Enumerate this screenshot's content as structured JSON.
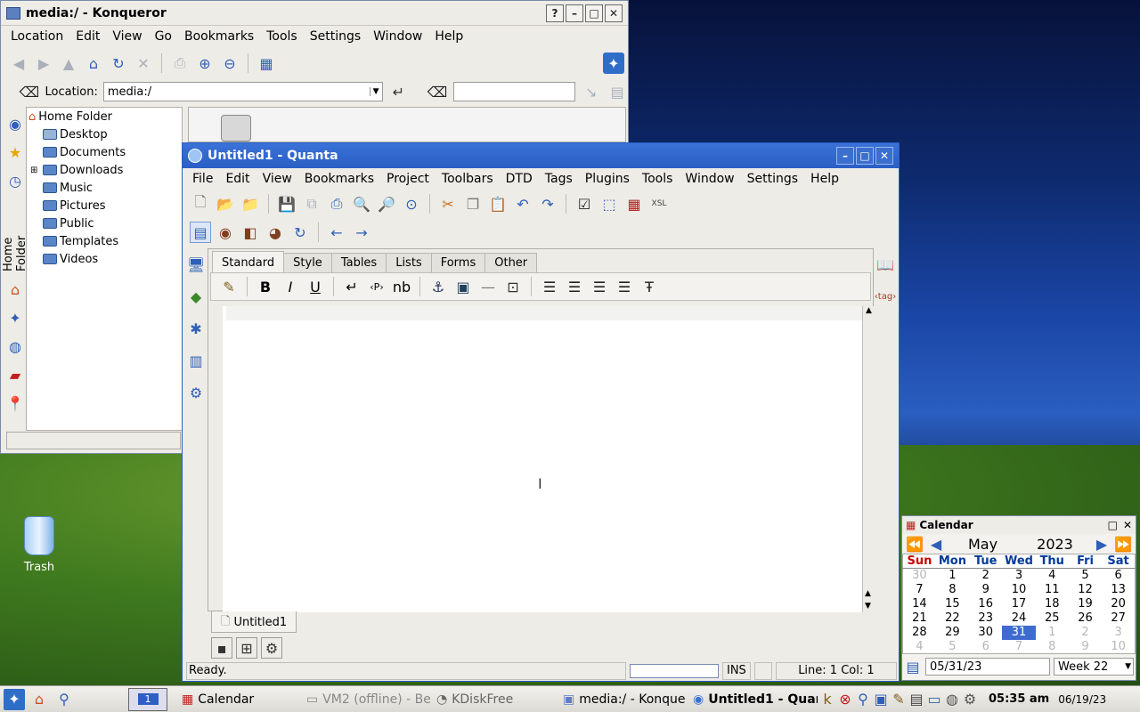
{
  "desktop": {
    "trash_label": "Trash"
  },
  "konqueror": {
    "title": "media:/ - Konqueror",
    "menu": [
      "Location",
      "Edit",
      "View",
      "Go",
      "Bookmarks",
      "Tools",
      "Settings",
      "Window",
      "Help"
    ],
    "location_label": "Location:",
    "location_value": "media:/",
    "sidebar_tab": "Home Folder",
    "tree": {
      "root": "Home Folder",
      "items": [
        "Desktop",
        "Documents",
        "Downloads",
        "Music",
        "Pictures",
        "Public",
        "Templates",
        "Videos"
      ]
    }
  },
  "quanta": {
    "title": "Untitled1 - Quanta",
    "menu": [
      "File",
      "Edit",
      "View",
      "Bookmarks",
      "Project",
      "Toolbars",
      "DTD",
      "Tags",
      "Plugins",
      "Tools",
      "Window",
      "Settings",
      "Help"
    ],
    "tabs": [
      "Standard",
      "Style",
      "Tables",
      "Lists",
      "Forms",
      "Other"
    ],
    "nbsp_label": "nb",
    "doc_tab": "Untitled1",
    "status": {
      "ready": "Ready.",
      "mode": "INS",
      "position": "Line: 1 Col: 1"
    }
  },
  "calendar": {
    "title": "Calendar",
    "month": "May",
    "year": "2023",
    "weekdays": [
      "Sun",
      "Mon",
      "Tue",
      "Wed",
      "Thu",
      "Fri",
      "Sat"
    ],
    "weeks": [
      [
        "30",
        "1",
        "2",
        "3",
        "4",
        "5",
        "6"
      ],
      [
        "7",
        "8",
        "9",
        "10",
        "11",
        "12",
        "13"
      ],
      [
        "14",
        "15",
        "16",
        "17",
        "18",
        "19",
        "20"
      ],
      [
        "21",
        "22",
        "23",
        "24",
        "25",
        "26",
        "27"
      ],
      [
        "28",
        "29",
        "30",
        "31",
        "1",
        "2",
        "3"
      ],
      [
        "4",
        "5",
        "6",
        "7",
        "8",
        "9",
        "10"
      ]
    ],
    "date_field": "05/31/23",
    "week_label": "Week 22"
  },
  "taskbar": {
    "desktop_num": "1",
    "tasks": [
      "Calendar",
      "VM2 (offline) - Be",
      "KDiskFree",
      "media:/ - Konque",
      "Untitled1 - Quan"
    ],
    "clock": "05:35 am",
    "date": "06/19/23"
  }
}
